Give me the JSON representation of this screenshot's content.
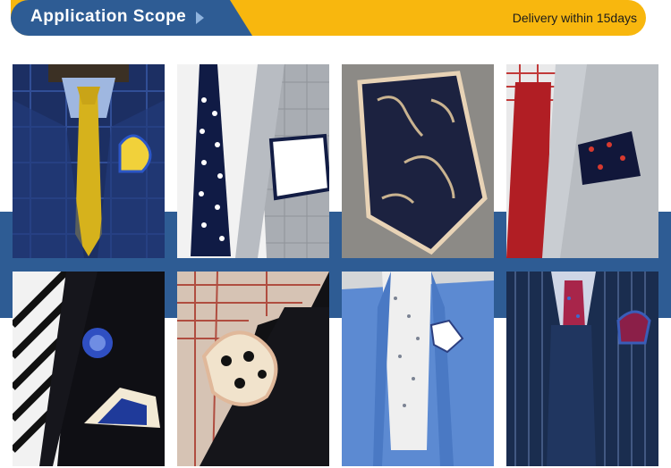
{
  "banner": {
    "title": "Application Scope",
    "delivery": "Delivery within 15days",
    "colors": {
      "blue": "#2e5c94",
      "yellow": "#f8b70e"
    }
  },
  "photos": [
    {
      "name": "blue-check-suit-yellow-paisley-tie"
    },
    {
      "name": "glen-check-suit-polka-dot-tie"
    },
    {
      "name": "paisley-pocket-square-closeup"
    },
    {
      "name": "grey-suit-red-tie-dotted-square"
    },
    {
      "name": "black-suit-striped-tie-rosette"
    },
    {
      "name": "black-jacket-dotted-square-plaid-shirt"
    },
    {
      "name": "light-blue-blazer-white-square"
    },
    {
      "name": "navy-pinstripe-suit-paisley-tie"
    }
  ]
}
